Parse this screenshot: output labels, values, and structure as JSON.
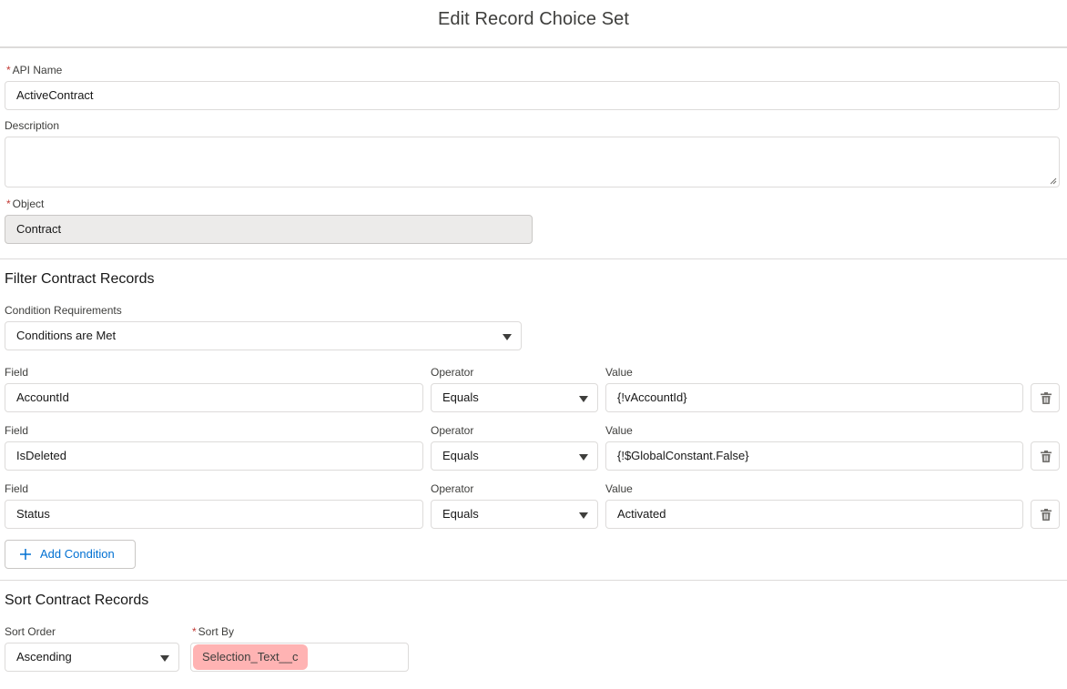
{
  "modal": {
    "title": "Edit Record Choice Set"
  },
  "general": {
    "api_name": {
      "required_marker": "*",
      "label": "API Name",
      "value": "ActiveContract"
    },
    "description": {
      "label": "Description",
      "value": ""
    },
    "object": {
      "required_marker": "*",
      "label": "Object",
      "value": "Contract"
    }
  },
  "filter": {
    "section_title": "Filter Contract Records",
    "condition_requirements": {
      "label": "Condition Requirements",
      "value": "Conditions are Met"
    },
    "conditions": [
      {
        "field_label": "Field",
        "field": "AccountId",
        "operator_label": "Operator",
        "operator": "Equals",
        "value_label": "Value",
        "value": "{!vAccountId}",
        "delete_icon": "trash-icon"
      },
      {
        "field_label": "Field",
        "field": "IsDeleted",
        "operator_label": "Operator",
        "operator": "Equals",
        "value_label": "Value",
        "value": "{!$GlobalConstant.False}",
        "delete_icon": "trash-icon"
      },
      {
        "field_label": "Field",
        "field": "Status",
        "operator_label": "Operator",
        "operator": "Equals",
        "value_label": "Value",
        "value": "Activated",
        "delete_icon": "trash-icon"
      }
    ],
    "add_condition_label": "Add Condition",
    "add_condition_icon": "plus-icon"
  },
  "sort": {
    "section_title": "Sort Contract Records",
    "sort_order": {
      "label": "Sort Order",
      "value": "Ascending"
    },
    "sort_by": {
      "required_marker": "*",
      "label": "Sort By",
      "value": "Selection_Text__c",
      "highlight_color": "#ffb3b3"
    }
  },
  "colors": {
    "link_blue": "#0070d2",
    "required_red": "#c23934",
    "border": "#dddbda",
    "readonly_bg": "#ecebea"
  }
}
